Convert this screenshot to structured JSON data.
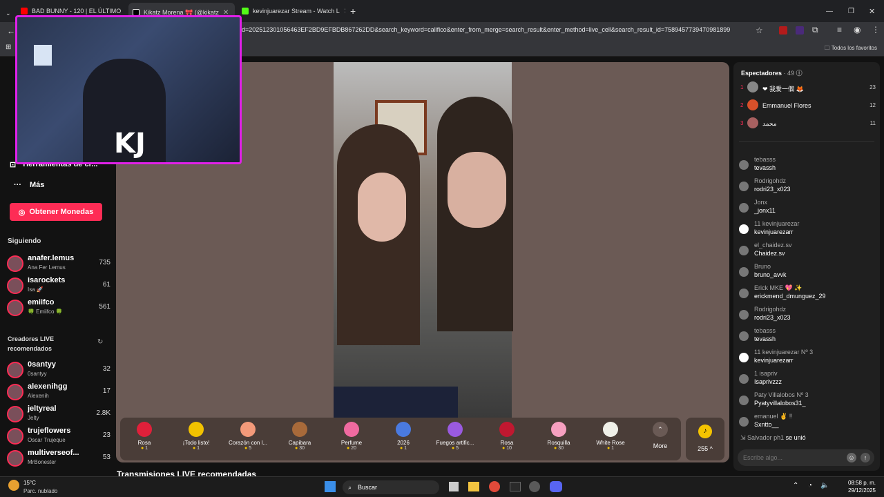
{
  "tabs": [
    {
      "label": "BAD BUNNY - 120 | EL ÚLTIMO",
      "color": "#ff0000"
    },
    {
      "label": "Kikatz Morena 🎀 (@kikatz",
      "color": "#000000"
    },
    {
      "label": "kevinjuarezar Stream - Watch L",
      "color": "#53fc18"
    }
  ],
  "address": {
    "url": "d=202512301056463EF2BD9EFBDB867262DD&search_keyword=califico&enter_from_merge=search_result&enter_method=live_cell&search_result_id=7589457739470981899"
  },
  "bookmarks": {
    "all_favorites": "Todos los favoritos"
  },
  "sidebar": {
    "tools_label": "Herramientas de cr...",
    "more_label": "Más",
    "coins_button": "Obtener Monedas",
    "following_title": "Siguiendo",
    "following": [
      {
        "name": "anafer.lemus",
        "sub": "Ana Fer Lemus",
        "count": "735"
      },
      {
        "name": "isarockets",
        "sub": "Isa 🚀",
        "count": "61"
      },
      {
        "name": "emiifco",
        "sub": "🍀 Emiifco 🍀",
        "count": "561"
      }
    ],
    "recommended_title": "Creadores LIVE recomendados",
    "recommended": [
      {
        "name": "0santyy",
        "sub": "0santyy",
        "count": "32"
      },
      {
        "name": "alexenihgg",
        "sub": "Alexenih",
        "count": "17"
      },
      {
        "name": "jeltyreal",
        "sub": "Jelty",
        "count": "2.8K"
      },
      {
        "name": "trujeflowers",
        "sub": "Oscar Trujeque",
        "count": "23"
      },
      {
        "name": "multiverseof...",
        "sub": "MrBonester",
        "count": "53"
      }
    ]
  },
  "overlay": {
    "initials": "KJ"
  },
  "gifts": [
    {
      "name": "Rosa",
      "price": "1",
      "color": "#e0203a"
    },
    {
      "name": "¡Todo listo!",
      "price": "1",
      "color": "#f2c200"
    },
    {
      "name": "Corazón con l...",
      "price": "5",
      "color": "#f39a7a"
    },
    {
      "name": "Capibara",
      "price": "30",
      "color": "#a86a3a"
    },
    {
      "name": "Perfume",
      "price": "20",
      "color": "#f06aa0"
    },
    {
      "name": "2026",
      "price": "1",
      "color": "#4a7ae0"
    },
    {
      "name": "Fuegos artific...",
      "price": "5",
      "color": "#9a5ae0"
    },
    {
      "name": "Rosa",
      "price": "10",
      "color": "#c01830"
    },
    {
      "name": "Rosquilla",
      "price": "30",
      "color": "#f6a0c0"
    },
    {
      "name": "White Rose",
      "price": "1",
      "color": "#f0f0e8"
    }
  ],
  "gift_more": "More",
  "coins": {
    "balance": "255 ^"
  },
  "recommended_live_title": "Transmisiones LIVE recomendadas",
  "viewers": {
    "title": "Espectadores",
    "count": "· 49"
  },
  "top_viewers": [
    {
      "rank": "1",
      "name": "❤ 我爱一個 🦊",
      "score": "23"
    },
    {
      "rank": "2",
      "name": "Emmanuel Flores",
      "score": "12"
    },
    {
      "rank": "3",
      "name": "محمد",
      "score": "11"
    }
  ],
  "chat": [
    {
      "user": "tebasss",
      "text": "tevassh"
    },
    {
      "user": "Rodrigohdz",
      "text": "rodri23_x023"
    },
    {
      "user": "Jonx",
      "text": "_jonx11"
    },
    {
      "user": "11 kevinjuarezar",
      "text": "kevinjuarezarr"
    },
    {
      "user": "el_chaidez.sv",
      "text": "Chaidez.sv"
    },
    {
      "user": "Bruno",
      "text": "bruno_avvk"
    },
    {
      "user": "Erick MKE 💖 ✨",
      "text": "erickmend_dmunguez_29"
    },
    {
      "user": "Rodrigohdz",
      "text": "rodri23_x023"
    },
    {
      "user": "tebasss",
      "text": "tevassh"
    },
    {
      "user": "11 kevinjuarezar  Nº 3",
      "text": "kevinjuarezarr"
    },
    {
      "user": "1 isapriv",
      "text": "Isaprivzzz"
    },
    {
      "user": "Paty Villalobos  Nº 3",
      "text": "Pyatyvillalobos31_"
    },
    {
      "user": "emanuel ✌ ‼",
      "text": "Sxntto__"
    }
  ],
  "joined": {
    "user": "Salvador ph1",
    "text": "se unió"
  },
  "chat_input": {
    "placeholder": "Escribe algo..."
  },
  "taskbar": {
    "temp": "15°C",
    "weather": "Parc. nublado",
    "search": "Buscar",
    "time": "08:58 p. m.",
    "date": "29/12/2025"
  }
}
